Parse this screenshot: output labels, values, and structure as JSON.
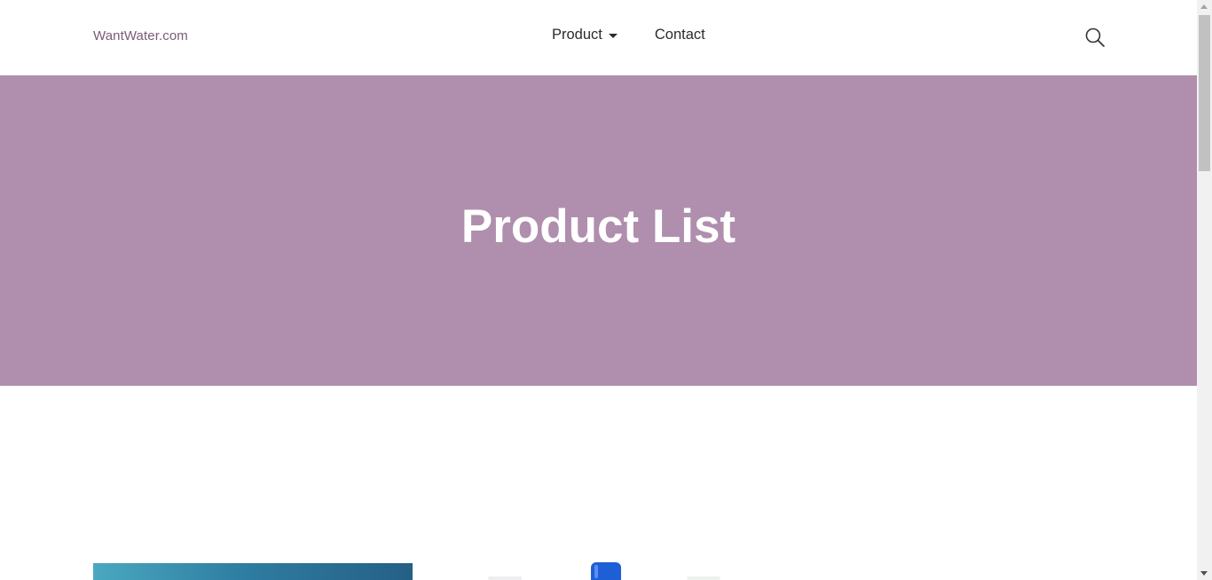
{
  "header": {
    "logo_text": "WantWater.com",
    "nav": {
      "product_label": "Product",
      "contact_label": "Contact"
    },
    "search_icon": "search-icon"
  },
  "hero": {
    "title": "Product List",
    "background_color": "#b08ead"
  },
  "products": {
    "items": [
      {
        "image": "water-photo-blue"
      },
      {
        "image": "water-bottle-blue-cap"
      }
    ]
  },
  "colors": {
    "accent": "#7a5a78",
    "hero_bg": "#b08ead",
    "text": "#2b2b2b"
  }
}
